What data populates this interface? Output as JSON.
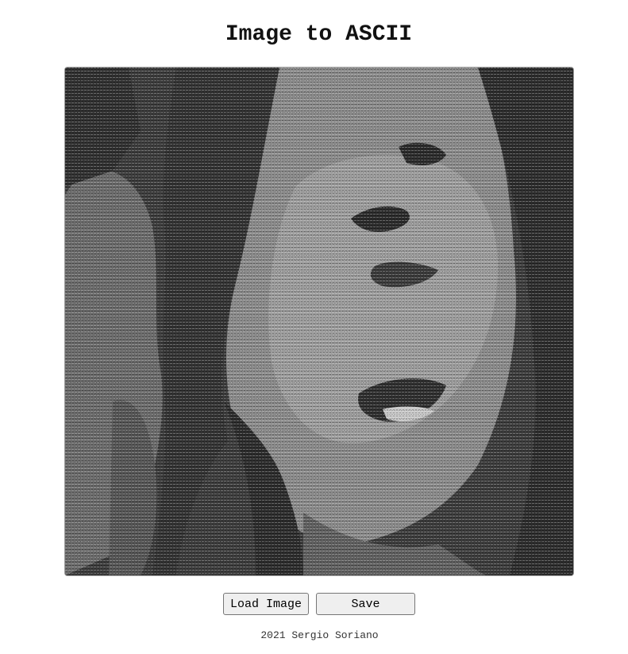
{
  "app": {
    "title": "Image to ASCII"
  },
  "controls": {
    "load_label": "Load Image",
    "save_label": "Save"
  },
  "footer": {
    "credit": "2021 Sergio Soriano"
  }
}
